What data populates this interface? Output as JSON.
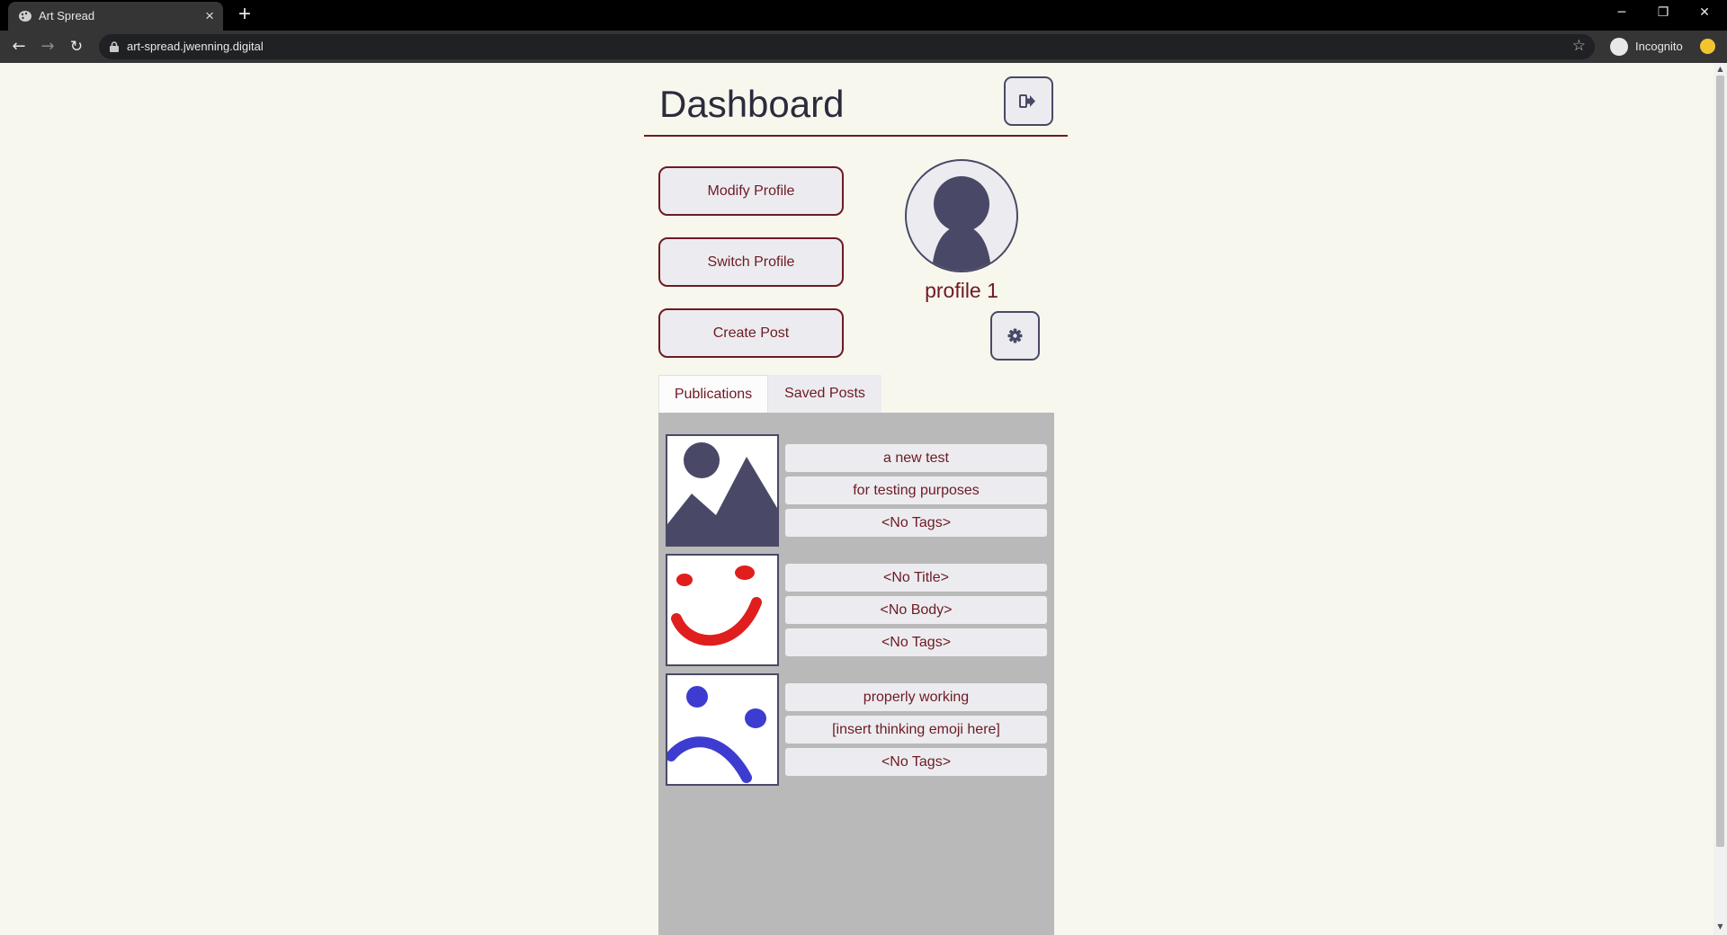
{
  "browser": {
    "tab_title": "Art Spread",
    "new_tab_glyph": "+",
    "url": "art-spread.jwenning.digital",
    "profile_label": "Incognito",
    "window_controls": [
      "minimize-icon",
      "restore-icon",
      "close-icon"
    ]
  },
  "page": {
    "title": "Dashboard",
    "actions": {
      "modify_profile": "Modify Profile",
      "switch_profile": "Switch Profile",
      "create_post": "Create Post"
    },
    "profile": {
      "name": "profile 1"
    },
    "tabs": {
      "publications": "Publications",
      "saved_posts": "Saved Posts"
    },
    "posts": [
      {
        "title": "a new test",
        "body": "for testing purposes",
        "tags": "<No Tags>",
        "thumbnail": "placeholder-image-icon"
      },
      {
        "title": "<No Title>",
        "body": "<No Body>",
        "tags": "<No Tags>",
        "thumbnail": "red-smiley-drawing"
      },
      {
        "title": "properly working",
        "body": "[insert thinking emoji here]",
        "tags": "<No Tags>",
        "thumbnail": "blue-frown-drawing"
      }
    ]
  },
  "colors": {
    "accent": "#6e1a23",
    "icon": "#494967",
    "page_bg": "#f8f7ee",
    "panel_bg": "#b9b9b9",
    "field_bg": "#ececf0"
  }
}
